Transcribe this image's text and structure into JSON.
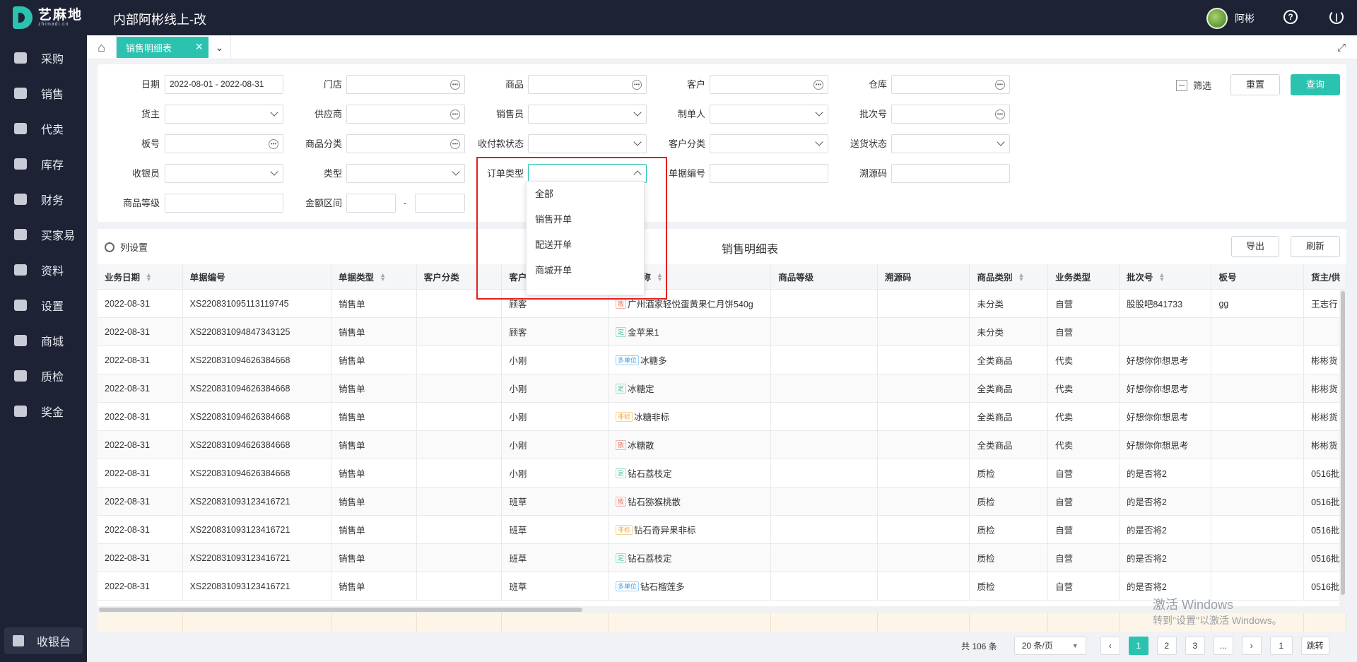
{
  "brand": {
    "name_cn": "艺麻地",
    "name_en": "zhimadi.cn"
  },
  "app_title": "内部阿彬线上-改",
  "user": {
    "name": "阿彬"
  },
  "sidebar": {
    "items": [
      {
        "label": "采购",
        "icon": "basket-icon"
      },
      {
        "label": "销售",
        "icon": "cart-icon"
      },
      {
        "label": "代卖",
        "icon": "tag-icon"
      },
      {
        "label": "库存",
        "icon": "warehouse-icon"
      },
      {
        "label": "财务",
        "icon": "yen-icon"
      },
      {
        "label": "买家易",
        "icon": "store-icon"
      },
      {
        "label": "资料",
        "icon": "printer-icon"
      },
      {
        "label": "设置",
        "icon": "gear-icon"
      },
      {
        "label": "商城",
        "icon": "shop-icon"
      },
      {
        "label": "质检",
        "icon": "basket-icon"
      },
      {
        "label": "奖金",
        "icon": "store-icon"
      }
    ],
    "cashier": "收银台"
  },
  "tabs": {
    "active": "销售明细表"
  },
  "filters": {
    "date_label": "日期",
    "date_value": "2022-08-01 - 2022-08-31",
    "store_label": "门店",
    "product_label": "商品",
    "customer_label": "客户",
    "warehouse_label": "仓库",
    "owner_label": "货主",
    "supplier_label": "供应商",
    "salesperson_label": "销售员",
    "creator_label": "制单人",
    "batch_label": "批次号",
    "board_label": "板号",
    "category_label": "商品分类",
    "payment_status_label": "收付款状态",
    "customer_category_label": "客户分类",
    "delivery_status_label": "送货状态",
    "cashier_label": "收银员",
    "type_label": "类型",
    "order_type_label": "订单类型",
    "doc_no_label": "单据编号",
    "trace_code_label": "溯源码",
    "grade_label": "商品等级",
    "amount_range_label": "金额区间",
    "range_dash": "-"
  },
  "actions": {
    "filter_label": "筛选",
    "reset_label": "重置",
    "query_label": "查询",
    "export_label": "导出",
    "refresh_label": "刷新",
    "column_settings_label": "列设置"
  },
  "table": {
    "title": "销售明细表",
    "headers": [
      "业务日期",
      "单据编号",
      "单据类型",
      "客户分类",
      "客户",
      "商品名称",
      "商品等级",
      "溯源码",
      "商品类别",
      "业务类型",
      "批次号",
      "板号",
      "货主/供"
    ],
    "rows": [
      {
        "date": "2022-08-31",
        "no": "XS220831095113119745",
        "type": "销售单",
        "cust_cat": "",
        "cust": "顾客",
        "badge": "散",
        "badge_class": "b-red",
        "product": "广州酒家轻悦蛋黄果仁月饼540g",
        "grade": "",
        "trace": "",
        "category": "未分类",
        "biz": "自营",
        "batch": "股股吧841733",
        "board": "gg",
        "owner": "王志行"
      },
      {
        "date": "2022-08-31",
        "no": "XS220831094847343125",
        "type": "销售单",
        "cust_cat": "",
        "cust": "顾客",
        "badge": "定",
        "badge_class": "b-green",
        "product": "金苹果1",
        "grade": "",
        "trace": "",
        "category": "未分类",
        "biz": "自营",
        "batch": "",
        "board": "",
        "owner": ""
      },
      {
        "date": "2022-08-31",
        "no": "XS220831094626384668",
        "type": "销售单",
        "cust_cat": "",
        "cust": "小刚",
        "badge": "多单位",
        "badge_class": "b-blue",
        "product": "冰糖多",
        "grade": "",
        "trace": "",
        "category": "全类商品",
        "biz": "代卖",
        "batch": "好想你你想思考",
        "board": "",
        "owner": "彬彬货"
      },
      {
        "date": "2022-08-31",
        "no": "XS220831094626384668",
        "type": "销售单",
        "cust_cat": "",
        "cust": "小刚",
        "badge": "定",
        "badge_class": "b-green",
        "product": "冰糖定",
        "grade": "",
        "trace": "",
        "category": "全类商品",
        "biz": "代卖",
        "batch": "好想你你想思考",
        "board": "",
        "owner": "彬彬货"
      },
      {
        "date": "2022-08-31",
        "no": "XS220831094626384668",
        "type": "销售单",
        "cust_cat": "",
        "cust": "小刚",
        "badge": "非标",
        "badge_class": "b-orange",
        "product": "冰糖非标",
        "grade": "",
        "trace": "",
        "category": "全类商品",
        "biz": "代卖",
        "batch": "好想你你想思考",
        "board": "",
        "owner": "彬彬货"
      },
      {
        "date": "2022-08-31",
        "no": "XS220831094626384668",
        "type": "销售单",
        "cust_cat": "",
        "cust": "小刚",
        "badge": "散",
        "badge_class": "b-red",
        "product": "冰糖散",
        "grade": "",
        "trace": "",
        "category": "全类商品",
        "biz": "代卖",
        "batch": "好想你你想思考",
        "board": "",
        "owner": "彬彬货"
      },
      {
        "date": "2022-08-31",
        "no": "XS220831094626384668",
        "type": "销售单",
        "cust_cat": "",
        "cust": "小刚",
        "badge": "定",
        "badge_class": "b-green",
        "product": "钻石荔枝定",
        "grade": "",
        "trace": "",
        "category": "质检",
        "biz": "自营",
        "batch": "的是否将2",
        "board": "",
        "owner": "0516批"
      },
      {
        "date": "2022-08-31",
        "no": "XS220831093123416721",
        "type": "销售单",
        "cust_cat": "",
        "cust": "班草",
        "badge": "散",
        "badge_class": "b-red",
        "product": "钻石猕猴桃散",
        "grade": "",
        "trace": "",
        "category": "质检",
        "biz": "自营",
        "batch": "的是否将2",
        "board": "",
        "owner": "0516批"
      },
      {
        "date": "2022-08-31",
        "no": "XS220831093123416721",
        "type": "销售单",
        "cust_cat": "",
        "cust": "班草",
        "badge": "非标",
        "badge_class": "b-orange",
        "product": "钻石奇异果非标",
        "grade": "",
        "trace": "",
        "category": "质检",
        "biz": "自营",
        "batch": "的是否将2",
        "board": "",
        "owner": "0516批"
      },
      {
        "date": "2022-08-31",
        "no": "XS220831093123416721",
        "type": "销售单",
        "cust_cat": "",
        "cust": "班草",
        "badge": "定",
        "badge_class": "b-green",
        "product": "钻石荔枝定",
        "grade": "",
        "trace": "",
        "category": "质检",
        "biz": "自营",
        "batch": "的是否将2",
        "board": "",
        "owner": "0516批"
      },
      {
        "date": "2022-08-31",
        "no": "XS220831093123416721",
        "type": "销售单",
        "cust_cat": "",
        "cust": "班草",
        "badge": "多单位",
        "badge_class": "b-blue",
        "product": "钻石榴莲多",
        "grade": "",
        "trace": "",
        "category": "质检",
        "biz": "自营",
        "batch": "的是否将2",
        "board": "",
        "owner": "0516批"
      }
    ]
  },
  "dropdown": {
    "options": [
      "全部",
      "销售开单",
      "配送开单",
      "商城开单"
    ]
  },
  "pagination": {
    "total": "共 106 条",
    "page_size": "20 条/页",
    "pages": [
      "1",
      "2",
      "3",
      "..."
    ],
    "jump_value": "1",
    "jump_label": "跳转"
  },
  "watermark": {
    "line1": "激活 Windows",
    "line2": "转到\"设置\"以激活 Windows。"
  }
}
